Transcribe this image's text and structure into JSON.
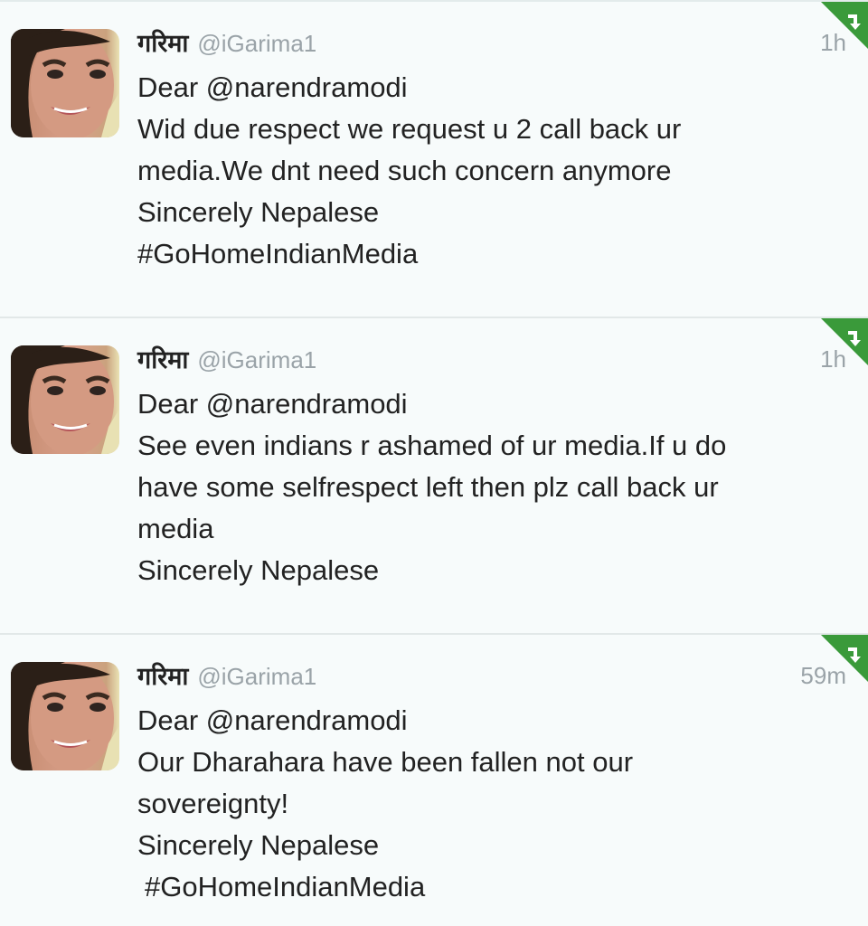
{
  "tweets": [
    {
      "display_name": "गरिमा",
      "handle": "@iGarima1",
      "time": "1h",
      "lines": [
        "Dear @narendramodi",
        "Wid due respect we request u 2 call back ur",
        "media.We dnt need such concern anymore",
        "Sincerely Nepalese",
        "#GoHomeIndianMedia"
      ]
    },
    {
      "display_name": "गरिमा",
      "handle": "@iGarima1",
      "time": "1h",
      "lines": [
        "Dear @narendramodi",
        "See even indians r ashamed of ur media.If u do",
        "have some selfrespect left then plz call back ur",
        "media",
        "Sincerely Nepalese"
      ]
    },
    {
      "display_name": "गरिमा",
      "handle": "@iGarima1",
      "time": "59m",
      "lines": [
        "Dear @narendramodi",
        "Our Dharahara have been fallen not our",
        "sovereignty!",
        "Sincerely Nepalese",
        "#GoHomeIndianMedia"
      ]
    }
  ],
  "colors": {
    "background": "#f7fbfb",
    "retweet_badge": "#3a9a3a",
    "muted_text": "#9aa3a8"
  }
}
